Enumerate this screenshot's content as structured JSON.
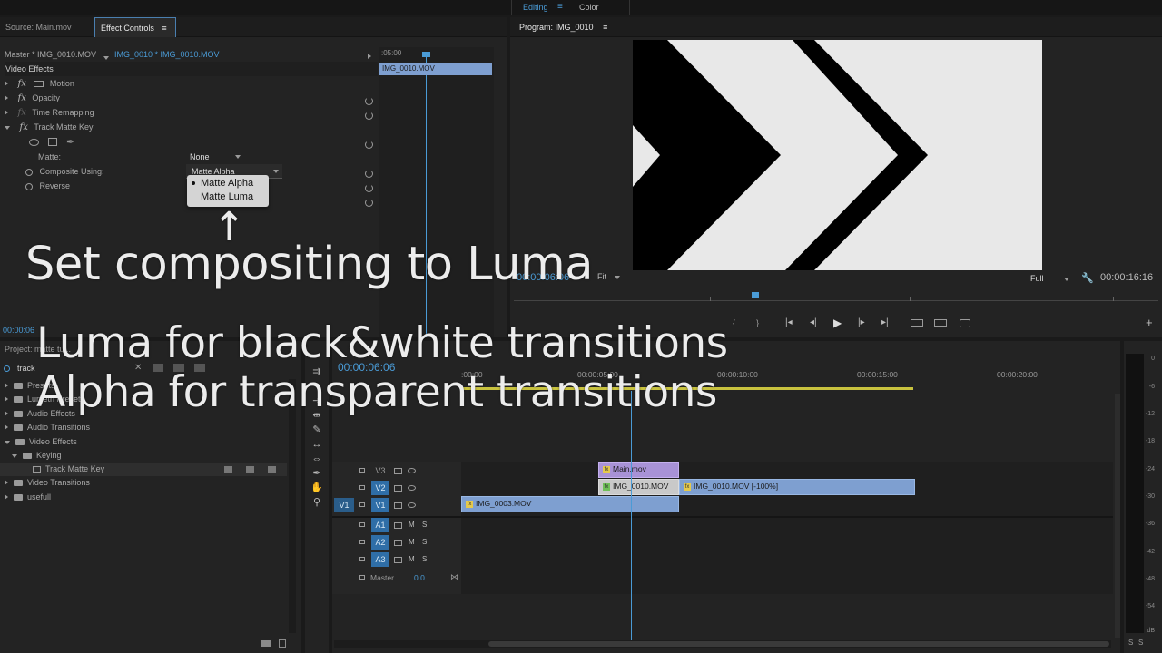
{
  "workspace": {
    "tabs": [
      "Editing",
      "Color"
    ],
    "menu_glyph": "≡"
  },
  "effect_panel": {
    "tabs": [
      "Source: Main.mov",
      "Effect Controls"
    ],
    "master_label": "Master * IMG_0010.MOV",
    "clip_label": "IMG_0010 * IMG_0010.MOV",
    "mini_time": ":05:00",
    "mini_clip": "IMG_0010.MOV",
    "section": "Video Effects",
    "effects": [
      "Motion",
      "Opacity",
      "Time Remapping",
      "Track Matte Key"
    ],
    "matte_label": "Matte:",
    "matte_value": "None",
    "composite_label": "Composite Using:",
    "composite_value": "Matte Alpha",
    "reverse_label": "Reverse",
    "dropdown_options": [
      "Matte Alpha",
      "Matte Luma"
    ],
    "bottom_time": "00:00:06"
  },
  "program": {
    "title": "Program: IMG_0010",
    "time_current": "00:00:06:06",
    "fit": "Fit",
    "quality": "Full",
    "duration": "00:00:16:16",
    "add_glyph": "+"
  },
  "project": {
    "title": "Project: matte tu...",
    "search_value": "track",
    "items": [
      {
        "label": "Presets",
        "level": 0,
        "open": false
      },
      {
        "label": "Lumetri Presets",
        "level": 0,
        "open": false
      },
      {
        "label": "Audio Effects",
        "level": 0,
        "open": false
      },
      {
        "label": "Audio Transitions",
        "level": 0,
        "open": false
      },
      {
        "label": "Video Effects",
        "level": 0,
        "open": true
      },
      {
        "label": "Keying",
        "level": 1,
        "open": true
      },
      {
        "label": "Track Matte Key",
        "level": 2,
        "open": false
      },
      {
        "label": "Video Transitions",
        "level": 0,
        "open": false
      },
      {
        "label": "usefull",
        "level": 0,
        "open": false
      }
    ]
  },
  "timeline": {
    "timecode": "00:00:06:06",
    "ruler": [
      ":00:00",
      "00:00:05:00",
      "00:00:10:00",
      "00:00:15:00",
      "00:00:20:00"
    ],
    "video_tracks": [
      "V3",
      "V2",
      "V1"
    ],
    "audio_tracks": [
      "A1",
      "A2",
      "A3"
    ],
    "source_patch": "V1",
    "ms": [
      "M",
      "S"
    ],
    "master_label": "Master",
    "master_value": "0.0",
    "clips": {
      "main": "Main.mov",
      "img0010a": "IMG_0010.MOV",
      "img0010b": "IMG_0010.MOV [-100%]",
      "img0003": "IMG_0003.MOV"
    }
  },
  "meter": {
    "ticks": [
      "0",
      "-6",
      "-12",
      "-18",
      "-24",
      "-30",
      "-36",
      "-42",
      "-48",
      "-54"
    ],
    "unit": "dB",
    "solo": [
      "S",
      "S"
    ]
  },
  "overlay": {
    "line1": "Set compositing to Luma",
    "line2": "Luma for black&white transitions",
    "line3": "Alpha for transparent transitions",
    "arrow": "↑"
  }
}
